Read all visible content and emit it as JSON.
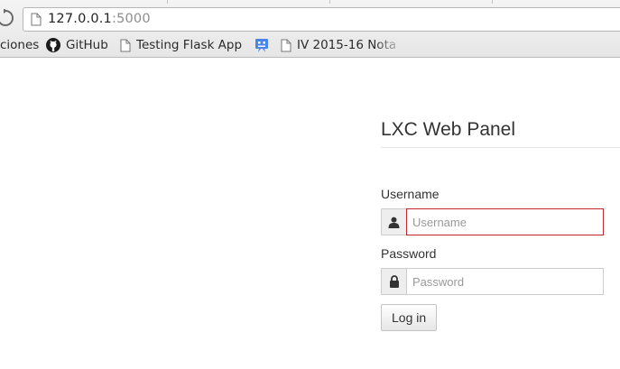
{
  "browser": {
    "url_host": "127.0.0.1",
    "url_port": ":5000",
    "bookmarks": [
      {
        "label": "ciones",
        "icon": "none"
      },
      {
        "label": "GitHub",
        "icon": "github-icon"
      },
      {
        "label": "Testing Flask App",
        "icon": "page-icon"
      },
      {
        "label": "",
        "icon": "robot-icon"
      },
      {
        "label": "IV 2015-16 Nota",
        "icon": "page-icon"
      }
    ]
  },
  "login": {
    "title": "LXC Web Panel",
    "username_label": "Username",
    "username_placeholder": "Username",
    "password_label": "Password",
    "password_placeholder": "Password",
    "submit_label": "Log in"
  },
  "colors": {
    "invalid_border": "#c0262d",
    "robot_icon": "#4a86e8"
  }
}
